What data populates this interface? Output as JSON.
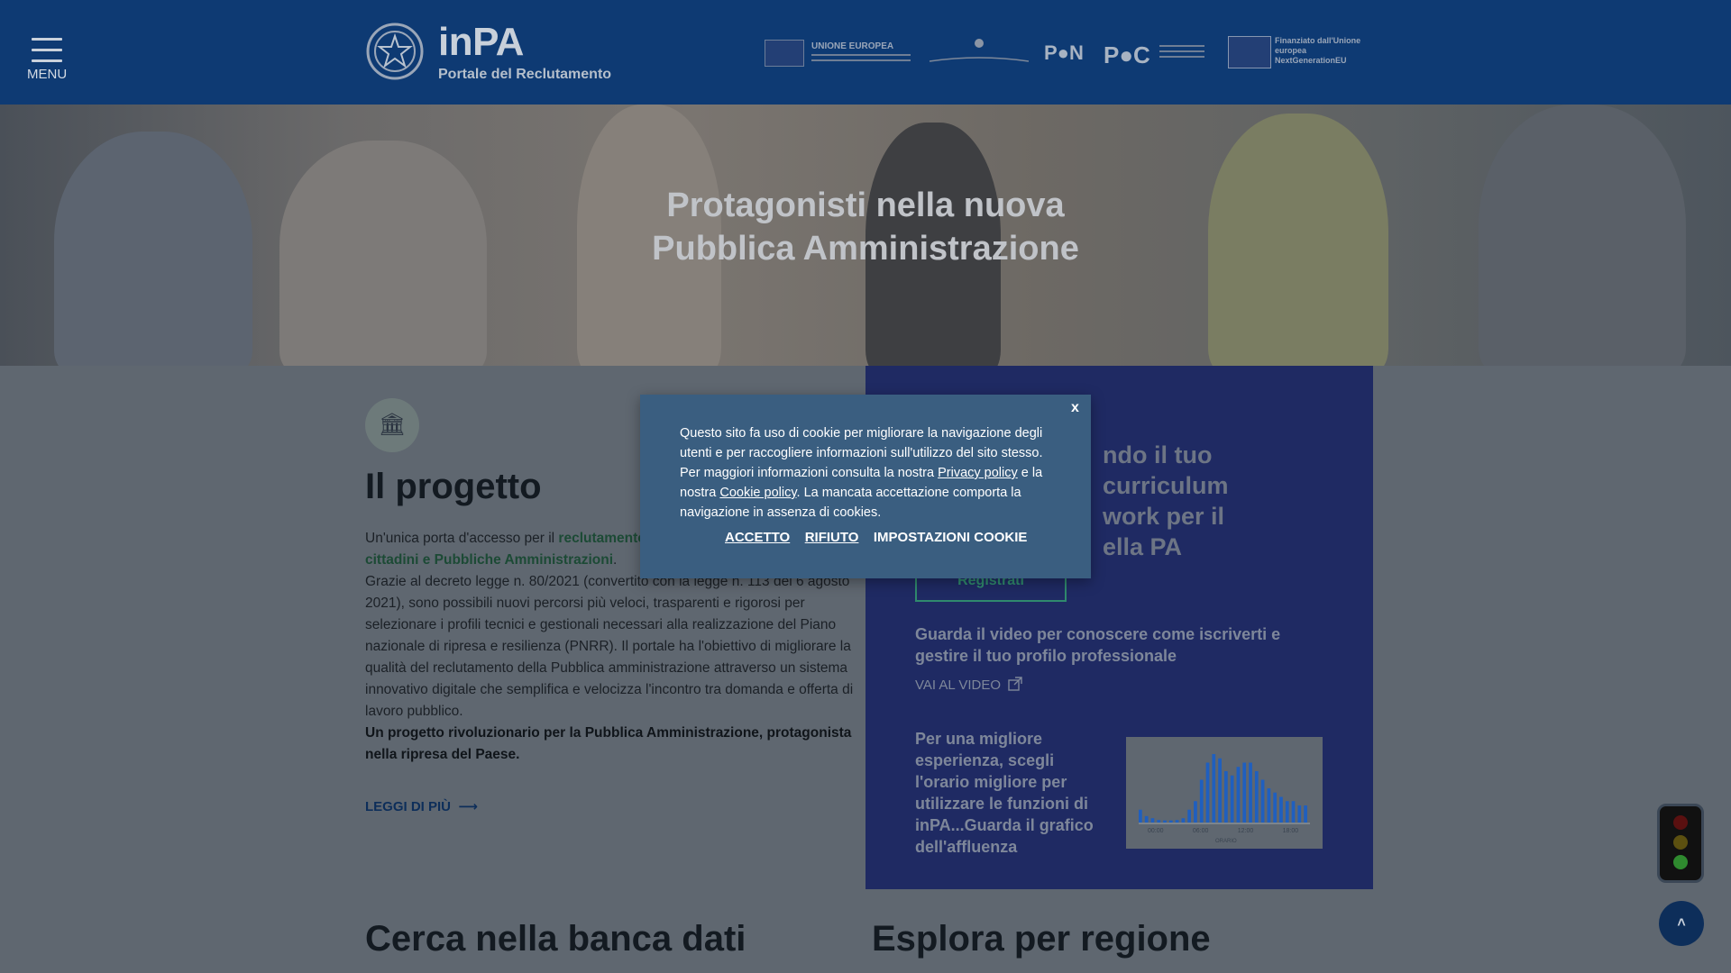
{
  "header": {
    "menu_label": "MENU",
    "brand_title": "inPA",
    "brand_subtitle": "Portale del Reclutamento",
    "partners": {
      "eu_label": "UNIONE EUROPEA",
      "pon": "P●N",
      "poc": "P●C",
      "ng_label": "Finanziato dall'Unione europea NextGenerationEU"
    }
  },
  "hero": {
    "title_line1": "Protagonisti nella nuova",
    "title_line2": "Pubblica Amministrazione"
  },
  "progetto": {
    "icon": "institution-icon",
    "title": "Il progetto",
    "intro_prefix": "Un'unica porta d'accesso per il ",
    "intro_link": "reclutamento",
    "intro_link2": "cittadini e Pubbliche Amministrazioni",
    "intro_suffix": ".",
    "body": "Grazie al decreto legge n. 80/2021 (convertito con la legge n. 113 del 6 agosto 2021), sono possibili nuovi percorsi più veloci, trasparenti e rigorosi per selezionare i profili tecnici e gestionali necessari alla realizzazione del Piano nazionale di ripresa e resilienza (PNRR). Il portale ha l'obiettivo di migliorare la qualità del reclutamento della Pubblica amministrazione attraverso un sistema innovativo digitale che semplifica e velocizza l'incontro tra domanda e offerta di lavoro pubblico.",
    "bold_line": "Un progetto rivoluzionario per la Pubblica Amministrazione, protagonista nella ripresa del Paese.",
    "read_more": "LEGGI DI PIÙ"
  },
  "panel": {
    "title_l1": "ndo il tuo curriculum",
    "title_l2": "work per il",
    "title_l3": "ella PA",
    "register_label": "Registrati",
    "video_text": "Guarda il video per conoscere come iscriverti e gestire il tuo profilo professionale",
    "video_link": "VAI AL VIDEO",
    "orario_text": "Per una migliore esperienza, scegli l'orario migliore per utilizzare le funzioni di inPA...Guarda il grafico dell'affluenza",
    "chart": {
      "ticks": [
        "00:00",
        "06:00",
        "12:00",
        "18:00"
      ],
      "xlabel": "ORARIO",
      "values": [
        3,
        1.5,
        1,
        0.6,
        0.5,
        0.5,
        0.6,
        1,
        3,
        5,
        10,
        14,
        16,
        15,
        12,
        11,
        13,
        14,
        14,
        12,
        10,
        8,
        7,
        6,
        5,
        5,
        4,
        4
      ],
      "color": "#1f5fbf"
    }
  },
  "sections": {
    "cerca": "Cerca nella banca dati",
    "esplora": "Esplora per regione"
  },
  "cookie": {
    "close": "x",
    "text_1": "Questo sito fa uso di cookie per migliorare la navigazione degli utenti e per raccogliere informazioni sull'utilizzo del sito stesso. Per maggiori informazioni consulta la nostra ",
    "privacy_link": "Privacy policy",
    "text_2": " e la nostra ",
    "cookie_link": "Cookie policy",
    "text_3": ". La mancata accettazione comporta la navigazione in assenza di cookies.",
    "accept": "ACCETTO",
    "reject": "RIFIUTO",
    "settings": "IMPOSTAZIONI COOKIE"
  },
  "widgets": {
    "back_to_top_icon": "chevron-up-icon",
    "traffic_light_icon": "traffic-light-icon"
  }
}
